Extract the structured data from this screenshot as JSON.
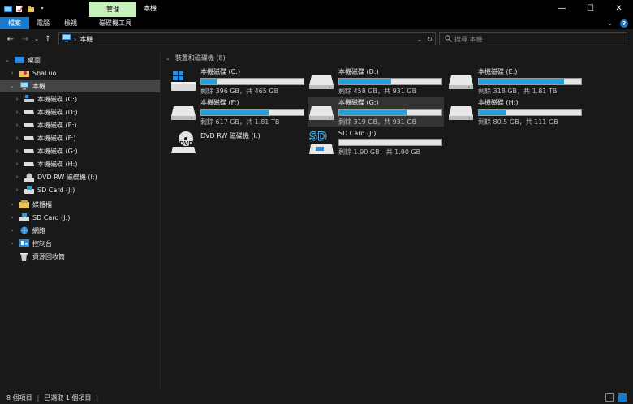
{
  "titlebar": {
    "context_tab": "管理",
    "window_title": "本機",
    "minimize": "—",
    "maximize": "☐",
    "close": "✕"
  },
  "ribbon": {
    "tabs": [
      "檔案",
      "電腦",
      "檢視"
    ],
    "drive_tools": "磁碟機工具"
  },
  "address": {
    "location": "本機",
    "search_placeholder": "搜尋 本機"
  },
  "nav": {
    "items": [
      {
        "label": "桌面",
        "icon": "desktop-icon"
      },
      {
        "label": "ShaLuo",
        "icon": "user-folder-icon"
      },
      {
        "label": "本機",
        "icon": "computer-icon"
      },
      {
        "label": "本機磁碟 (C:)",
        "icon": "drive-icon"
      },
      {
        "label": "本機磁碟 (D:)",
        "icon": "drive-icon"
      },
      {
        "label": "本機磁碟 (E:)",
        "icon": "drive-icon"
      },
      {
        "label": "本機磁碟 (F:)",
        "icon": "drive-icon"
      },
      {
        "label": "本機磁碟 (G:)",
        "icon": "drive-icon"
      },
      {
        "label": "本機磁碟 (H:)",
        "icon": "drive-icon"
      },
      {
        "label": "DVD RW 磁碟機 (I:)",
        "icon": "dvd-icon"
      },
      {
        "label": "SD Card (J:)",
        "icon": "sd-card-icon"
      },
      {
        "label": "媒體櫃",
        "icon": "library-icon"
      },
      {
        "label": "SD Card (J:)",
        "icon": "sd-card-icon"
      },
      {
        "label": "網路",
        "icon": "network-icon"
      },
      {
        "label": "控制台",
        "icon": "control-panel-icon"
      },
      {
        "label": "資源回收筒",
        "icon": "recycle-bin-icon"
      }
    ]
  },
  "content": {
    "group_header": "裝置和磁碟機 (8)",
    "drives": [
      {
        "name": "本機磁碟 (C:)",
        "free": "剩餘 396 GB，共 465 GB",
        "used_fraction": 0.15,
        "icon": "windows-drive-icon"
      },
      {
        "name": "本機磁碟 (D:)",
        "free": "剩餘 458 GB，共 931 GB",
        "used_fraction": 0.51,
        "icon": "drive-icon"
      },
      {
        "name": "本機磁碟 (E:)",
        "free": "剩餘 318 GB，共 1.81 TB",
        "used_fraction": 0.83,
        "icon": "drive-icon"
      },
      {
        "name": "本機磁碟 (F:)",
        "free": "剩餘 617 GB，共 1.81 TB",
        "used_fraction": 0.67,
        "icon": "drive-icon"
      },
      {
        "name": "本機磁碟 (G:)",
        "free": "剩餘 319 GB，共 931 GB",
        "used_fraction": 0.66,
        "icon": "drive-icon"
      },
      {
        "name": "本機磁碟 (H:)",
        "free": "剩餘 80.5 GB，共 111 GB",
        "used_fraction": 0.27,
        "icon": "drive-icon"
      },
      {
        "name": "DVD RW 磁碟機 (I:)",
        "free": "",
        "used_fraction": 0,
        "icon": "dvd-icon"
      },
      {
        "name": "SD Card (J:)",
        "free": "剩餘 1.90 GB，共 1.90 GB",
        "used_fraction": 0.0,
        "icon": "sd-card-icon"
      }
    ]
  },
  "status": {
    "count": "8 個項目",
    "selected": "已選取 1 個項目"
  },
  "colors": {
    "accent": "#1979ca",
    "bar_fill": "#26a0da",
    "context_tab": "#c7f1ba"
  }
}
